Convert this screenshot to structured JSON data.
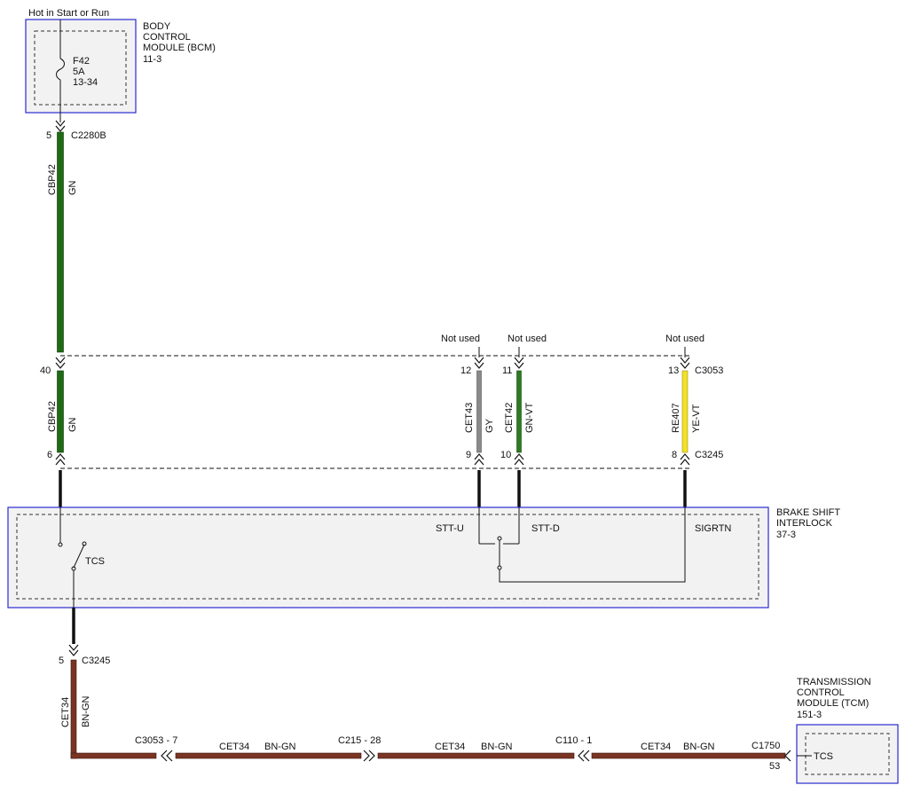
{
  "supply_label": "Hot in Start or Run",
  "bcm": {
    "name_lines": [
      "BODY",
      "CONTROL",
      "MODULE (BCM)",
      "11-3"
    ],
    "fuse_lines": [
      "F42",
      "5A",
      "13-34"
    ]
  },
  "connectors": {
    "c2280b": {
      "id": "C2280B",
      "pin": "5"
    },
    "inline_top": {
      "pins": [
        "40",
        "12",
        "11",
        "13"
      ],
      "id": "C3053"
    },
    "inline_bottom": {
      "pins": [
        "6",
        "9",
        "10",
        "8"
      ],
      "id": "C3245"
    },
    "bsi_out": {
      "pin": "5",
      "id": "C3245"
    },
    "tcm_in": {
      "pin": "53",
      "id": "C1750"
    }
  },
  "not_used_label": "Not used",
  "wires": [
    {
      "circuit": "CBP42",
      "color_code": "GN",
      "color": "#1e6b14"
    },
    {
      "circuit": "CBP42",
      "color_code": "GN",
      "color": "#1e6b14"
    },
    {
      "circuit": "CET43",
      "color_code": "GY",
      "color": "#8a8a8a"
    },
    {
      "circuit": "CET42",
      "color_code": "GN-VT",
      "color": "#2e7a22"
    },
    {
      "circuit": "RE407",
      "color_code": "YE-VT",
      "color": "#f2e02a"
    },
    {
      "circuit": "CET34",
      "color_code": "BN-GN",
      "color": "#7a3423"
    }
  ],
  "bsi": {
    "name_lines": [
      "BRAKE SHIFT",
      "INTERLOCK",
      "37-3"
    ],
    "switch_label": "TCS",
    "pin_labels": [
      "STT-U",
      "STT-D",
      "SIGRTN"
    ]
  },
  "bottom_run": {
    "inline_connectors": [
      "C3053 - 7",
      "C215 - 28",
      "C110 - 1"
    ],
    "segments": [
      {
        "circuit": "CET34",
        "color_code": "BN-GN"
      },
      {
        "circuit": "CET34",
        "color_code": "BN-GN"
      },
      {
        "circuit": "CET34",
        "color_code": "BN-GN"
      }
    ]
  },
  "tcm": {
    "name_lines": [
      "TRANSMISSION",
      "CONTROL",
      "MODULE (TCM)",
      "151-3"
    ],
    "internal_label": "TCS"
  },
  "colors": {
    "module_border": "#2a2ad0",
    "module_fill": "#f2f2f2",
    "wire_black": "#111111"
  }
}
